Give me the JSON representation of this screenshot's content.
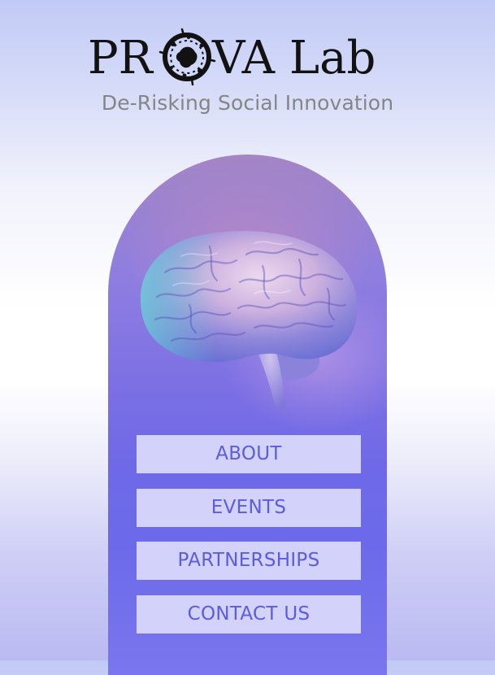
{
  "header": {
    "logo_text": "PROVA Lab",
    "tagline": "De-Risking Social Innovation"
  },
  "hero": {
    "image": "brain-illustration"
  },
  "menu": {
    "items": [
      {
        "label": "ABOUT"
      },
      {
        "label": "EVENTS"
      },
      {
        "label": "PARTNERSHIPS"
      },
      {
        "label": "CONTACT US"
      }
    ]
  },
  "colors": {
    "menu_button_bg": "#d2d2fa",
    "menu_button_text": "#5c5ce0",
    "logo_text": "#121212",
    "tagline_text": "#858585",
    "arch_purple": "#6f69e7"
  }
}
